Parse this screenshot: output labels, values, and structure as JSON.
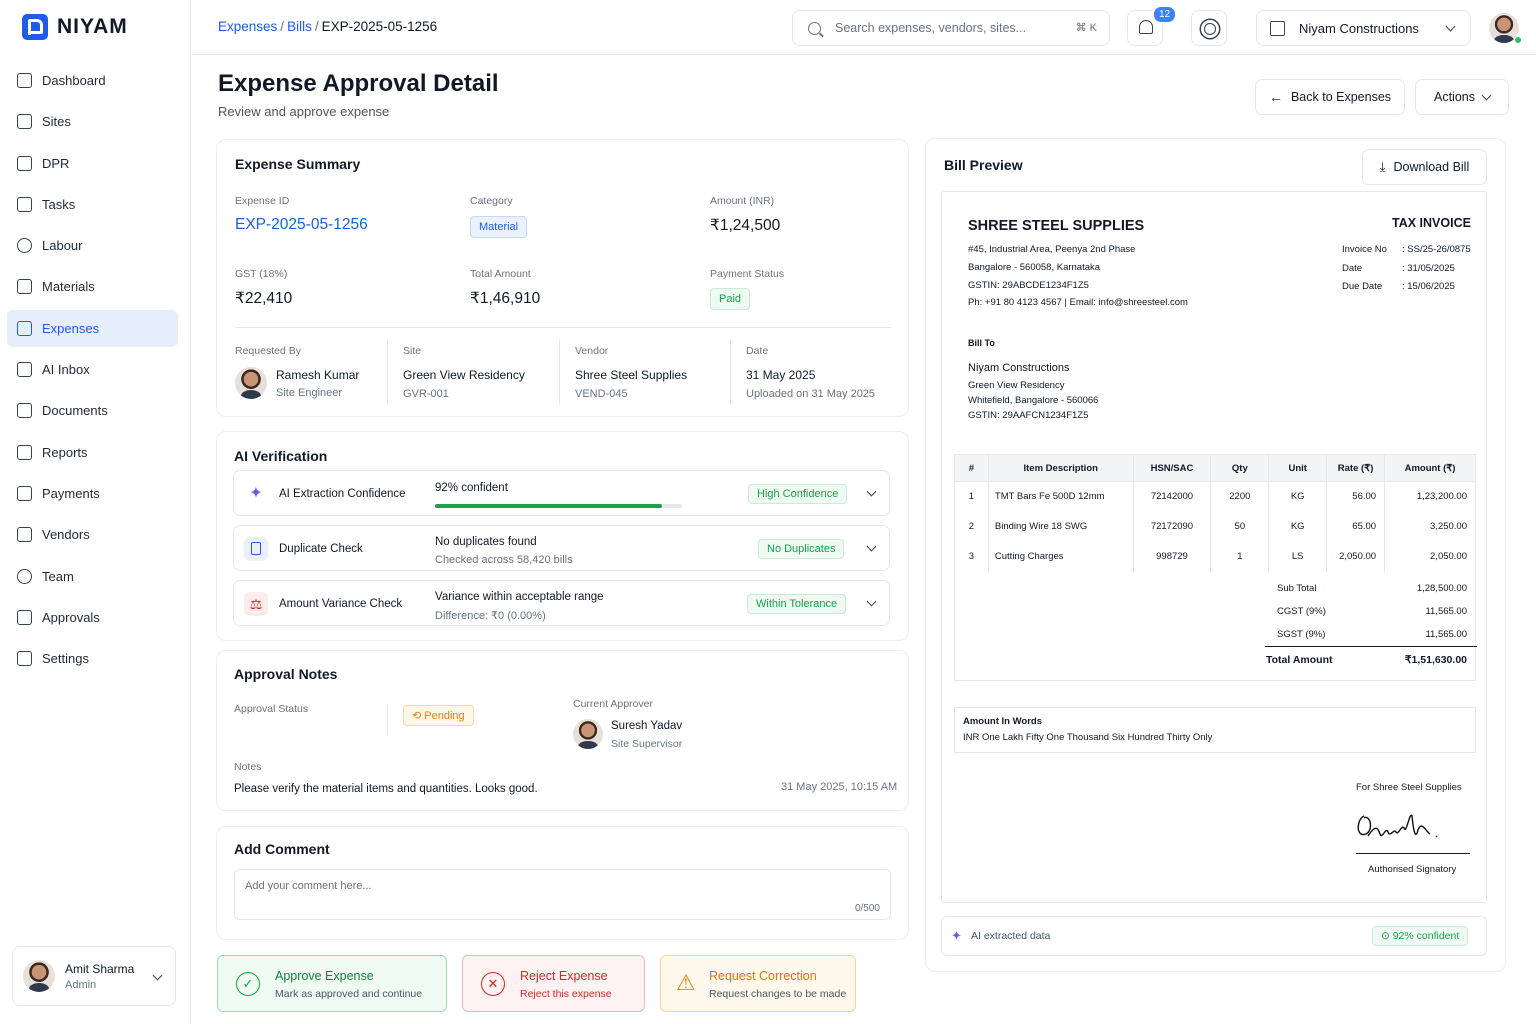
{
  "brand": {
    "name": "NIYAM"
  },
  "sidebar": {
    "items": [
      {
        "label": "Dashboard",
        "icon": "home-icon"
      },
      {
        "label": "Sites",
        "icon": "building-icon"
      },
      {
        "label": "DPR",
        "icon": "file-icon"
      },
      {
        "label": "Tasks",
        "icon": "calendar-check-icon"
      },
      {
        "label": "Labour",
        "icon": "users-icon"
      },
      {
        "label": "Materials",
        "icon": "box-icon"
      },
      {
        "label": "Expenses",
        "icon": "receipt-icon",
        "active": true
      },
      {
        "label": "AI Inbox",
        "icon": "chat-icon"
      },
      {
        "label": "Documents",
        "icon": "document-icon"
      },
      {
        "label": "Reports",
        "icon": "report-icon"
      },
      {
        "label": "Payments",
        "icon": "wallet-icon"
      },
      {
        "label": "Vendors",
        "icon": "cart-icon"
      },
      {
        "label": "Team",
        "icon": "team-icon"
      },
      {
        "label": "Approvals",
        "icon": "check-circle-icon"
      },
      {
        "label": "Settings",
        "icon": "gear-icon"
      }
    ],
    "user": {
      "name": "Amit Sharma",
      "role": "Admin"
    }
  },
  "header": {
    "breadcrumb": [
      "Expenses",
      "Bills",
      "EXP-2025-05-1256"
    ],
    "search_placeholder": "Search expenses, vendors, sites...",
    "search_shortcut": "⌘ K",
    "notification_count": "12",
    "org": "Niyam Constructions"
  },
  "page": {
    "title": "Expense Approval Detail",
    "subtitle": "Review and approve expense",
    "back_label": "Back to Expenses",
    "actions_label": "Actions"
  },
  "summary": {
    "title": "Expense Summary",
    "expense_id_label": "Expense ID",
    "expense_id": "EXP-2025-05-1256",
    "category_label": "Category",
    "category": "Material",
    "amount_label": "Amount (INR)",
    "amount": "₹1,24,500",
    "gst_label": "GST (18%)",
    "gst": "₹22,410",
    "total_label": "Total Amount",
    "total": "₹1,46,910",
    "payment_status_label": "Payment Status",
    "payment_status": "Paid",
    "requested_by_label": "Requested By",
    "requester_name": "Ramesh Kumar",
    "requester_role": "Site Engineer",
    "site_label": "Site",
    "site_name": "Green View Residency",
    "site_code": "GVR-001",
    "vendor_label": "Vendor",
    "vendor_name": "Shree Steel Supplies",
    "vendor_code": "VEND-045",
    "date_label": "Date",
    "date": "31 May 2025",
    "uploaded": "Uploaded on 31 May 2025"
  },
  "ai": {
    "title": "AI Verification",
    "rows": [
      {
        "label": "AI Extraction Confidence",
        "line1": "92% confident",
        "line2": "",
        "badge": "High Confidence",
        "confidence": 0.92
      },
      {
        "label": "Duplicate Check",
        "line1": "No duplicates found",
        "line2": "Checked across 58,420 bills",
        "badge": "No Duplicates"
      },
      {
        "label": "Amount Variance Check",
        "line1": "Variance within acceptable range",
        "line2": "Difference: ₹0 (0.00%)",
        "badge": "Within Tolerance"
      }
    ]
  },
  "notes": {
    "title": "Approval Notes",
    "status_label": "Approval Status",
    "status": "Pending",
    "approver_label": "Current Approver",
    "approver_name": "Suresh Yadav",
    "approver_role": "Site Supervisor",
    "notes_label": "Notes",
    "notes_text": "Please verify the material items and quantities. Looks good.",
    "timestamp": "31 May 2025, 10:15 AM"
  },
  "comment": {
    "title": "Add Comment",
    "placeholder": "Add your comment here...",
    "counter": "0/500"
  },
  "actions": [
    {
      "title": "Approve Expense",
      "sub": "Mark as approved and continue"
    },
    {
      "title": "Reject Expense",
      "sub": "Reject this expense"
    },
    {
      "title": "Request Correction",
      "sub": "Request changes to be made"
    }
  ],
  "bill": {
    "title": "Bill Preview",
    "download_label": "Download Bill",
    "vendor": "SHREE STEEL SUPPLIES",
    "addr1": "#45, Industrial Area, Peenya 2nd Phase",
    "addr2": "Bangalore - 560058, Karnataka",
    "gstin": "GSTIN: 29ABCDE1234F1Z5",
    "contact": "Ph: +91 80 4123 4567  |  Email: info@shreesteel.com",
    "doc_type": "TAX INVOICE",
    "meta": [
      {
        "k": "Invoice No",
        "v": ": SS/25-26/0875"
      },
      {
        "k": "Date",
        "v": ": 31/05/2025"
      },
      {
        "k": "Due Date",
        "v": ": 15/06/2025"
      }
    ],
    "bill_to_label": "Bill To",
    "bill_to_name": "Niyam Constructions",
    "bill_to_1": "Green View Residency",
    "bill_to_2": "Whitefield, Bangalore - 560066",
    "bill_to_gstin": "GSTIN: 29AAFCN1234F1Z5",
    "columns": [
      "#",
      "Item Description",
      "HSN/SAC",
      "Qty",
      "Unit",
      "Rate (₹)",
      "Amount (₹)"
    ],
    "rows": [
      [
        "1",
        "TMT Bars Fe 500D 12mm",
        "72142000",
        "2200",
        "KG",
        "56.00",
        "1,23,200.00"
      ],
      [
        "2",
        "Binding Wire 18 SWG",
        "72172090",
        "50",
        "KG",
        "65.00",
        "3,250.00"
      ],
      [
        "3",
        "Cutting Charges",
        "998729",
        "1",
        "LS",
        "2,050.00",
        "2,050.00"
      ]
    ],
    "subtotal_label": "Sub Total",
    "subtotal": "1,28,500.00",
    "cgst_label": "CGST (9%)",
    "cgst": "11,565.00",
    "sgst_label": "SGST (9%)",
    "sgst": "11,565.00",
    "total_label": "Total Amount",
    "total": "₹1,51,630.00",
    "words_label": "Amount In Words",
    "words": "INR One Lakh Fifty One Thousand Six Hundred Thirty Only",
    "for_label": "For Shree Steel Supplies",
    "signatory": "Authorised Signatory",
    "ai_label": "AI extracted data",
    "ai_conf": "92% confident"
  }
}
